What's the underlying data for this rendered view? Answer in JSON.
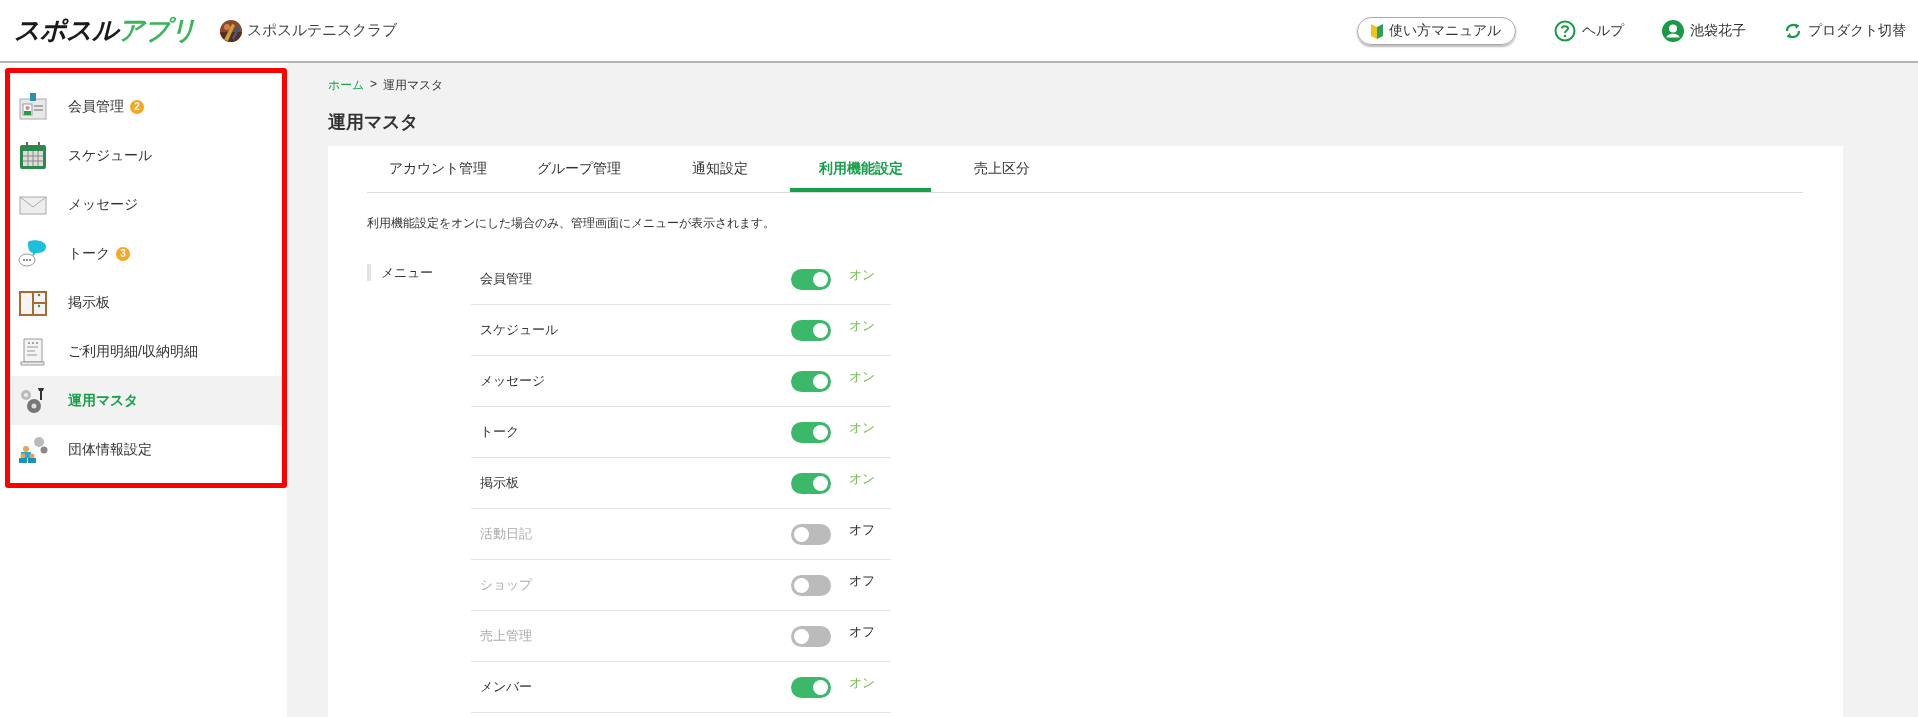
{
  "header": {
    "logo": {
      "text": "スポスル",
      "accent": "アプリ"
    },
    "club": {
      "name": "スポスルテニスクラブ"
    },
    "links": [
      {
        "kind": "manual",
        "label": "使い方マニュアル"
      },
      {
        "kind": "help",
        "label": "ヘルプ"
      },
      {
        "kind": "user",
        "label": "池袋花子"
      },
      {
        "kind": "switch",
        "label": "プロダクト切替"
      }
    ]
  },
  "sidebar": {
    "highlighted": true,
    "items": [
      {
        "label": "会員管理",
        "badge": "2",
        "selected": false
      },
      {
        "label": "スケジュール",
        "selected": false
      },
      {
        "label": "メッセージ",
        "selected": false
      },
      {
        "label": "トーク",
        "badge": "3",
        "selected": false
      },
      {
        "label": "掲示板",
        "selected": false
      },
      {
        "label": "ご利用明細/収納明細",
        "selected": false
      },
      {
        "label": "運用マスタ",
        "selected": true
      },
      {
        "label": "団体情報設定",
        "selected": false
      }
    ]
  },
  "breadcrumb": [
    {
      "label": "ホーム",
      "link": true
    },
    {
      "label": ">",
      "link": false
    },
    {
      "label": "運用マスタ",
      "link": false
    }
  ],
  "page_title": "運用マスタ",
  "tabs": [
    {
      "label": "アカウント管理",
      "selected": false
    },
    {
      "label": "グループ管理",
      "selected": false
    },
    {
      "label": "通知設定",
      "selected": false
    },
    {
      "label": "利用機能設定",
      "selected": true
    },
    {
      "label": "売上区分",
      "selected": false
    }
  ],
  "description": "利用機能設定をオンにした場合のみ、管理画面にメニューが表示されます。",
  "section_label": "メニュー",
  "features": [
    {
      "name": "会員管理",
      "on": true,
      "state_text": "オン"
    },
    {
      "name": "スケジュール",
      "on": true,
      "state_text": "オン"
    },
    {
      "name": "メッセージ",
      "on": true,
      "state_text": "オン"
    },
    {
      "name": "トーク",
      "on": true,
      "state_text": "オン"
    },
    {
      "name": "掲示板",
      "on": true,
      "state_text": "オン"
    },
    {
      "name": "活動日記",
      "on": false,
      "state_text": "オフ"
    },
    {
      "name": "ショップ",
      "on": false,
      "state_text": "オフ"
    },
    {
      "name": "売上管理",
      "on": false,
      "state_text": "オフ"
    },
    {
      "name": "メンバー",
      "on": true,
      "state_text": "オン"
    }
  ]
}
